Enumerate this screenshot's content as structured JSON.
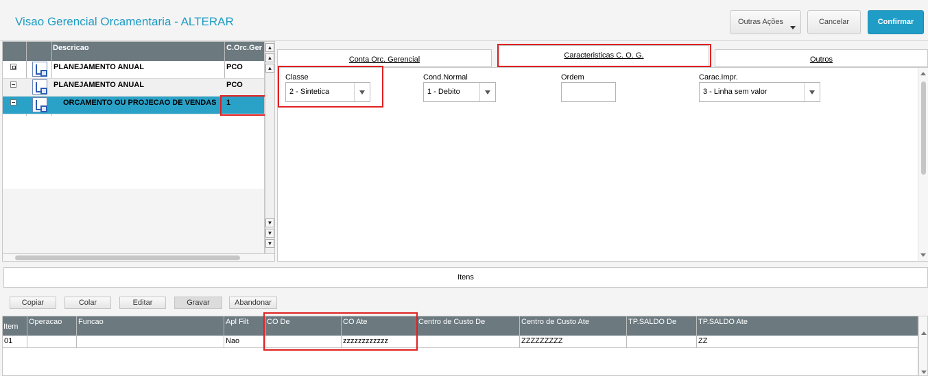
{
  "header": {
    "title": "Visao Gerencial Orcamentaria - ALTERAR",
    "other_actions": "Outras Ações",
    "cancel": "Cancelar",
    "confirm": "Confirmar"
  },
  "tree": {
    "columns": [
      "Descricao",
      "C.Orc.Ger"
    ],
    "rows": [
      {
        "descricao": "PLANEJAMENTO ANUAL",
        "code": "PCO",
        "selected": false
      },
      {
        "descricao": "PLANEJAMENTO ANUAL",
        "code": "PCO",
        "selected": false
      },
      {
        "descricao": "ORCAMENTO OU PROJECAO DE VENDAS",
        "code": "1",
        "selected": true
      }
    ]
  },
  "tabs": [
    {
      "label": "Conta Orc. Gerencial"
    },
    {
      "label": "Caracteristicas C. O. G."
    },
    {
      "label": "Outros"
    }
  ],
  "form": {
    "classe": {
      "label": "Classe",
      "value": "2 - Sintetica"
    },
    "cond_normal": {
      "label": "Cond.Normal",
      "value": "1 - Debito"
    },
    "ordem": {
      "label": "Ordem",
      "value": ""
    },
    "carac_impr": {
      "label": "Carac.Impr.",
      "value": "3 - Linha sem valor"
    }
  },
  "itens": {
    "title": "Itens",
    "buttons": [
      "Copiar",
      "Colar",
      "Editar",
      "Gravar",
      "Abandonar"
    ],
    "columns": [
      "Item",
      "Operacao",
      "Funcao",
      "Apl Filt",
      "CO De",
      "CO Ate",
      "Centro de Custo De",
      "Centro de Custo Ate",
      "TP.SALDO De",
      "TP.SALDO Ate"
    ],
    "rows": [
      {
        "item": "01",
        "operacao": "",
        "funcao": "",
        "apl_filt": "Nao",
        "co_de": "",
        "co_ate": "zzzzzzzzzzzz",
        "cc_de": "",
        "cc_ate": "ZZZZZZZZZ",
        "tp_de": "",
        "tp_ate": "ZZ"
      }
    ]
  },
  "colors": {
    "accent": "#1f9dc6",
    "header_bg": "#6c7a80",
    "selected_row": "#2aa2c8",
    "highlight": "#e02020"
  }
}
